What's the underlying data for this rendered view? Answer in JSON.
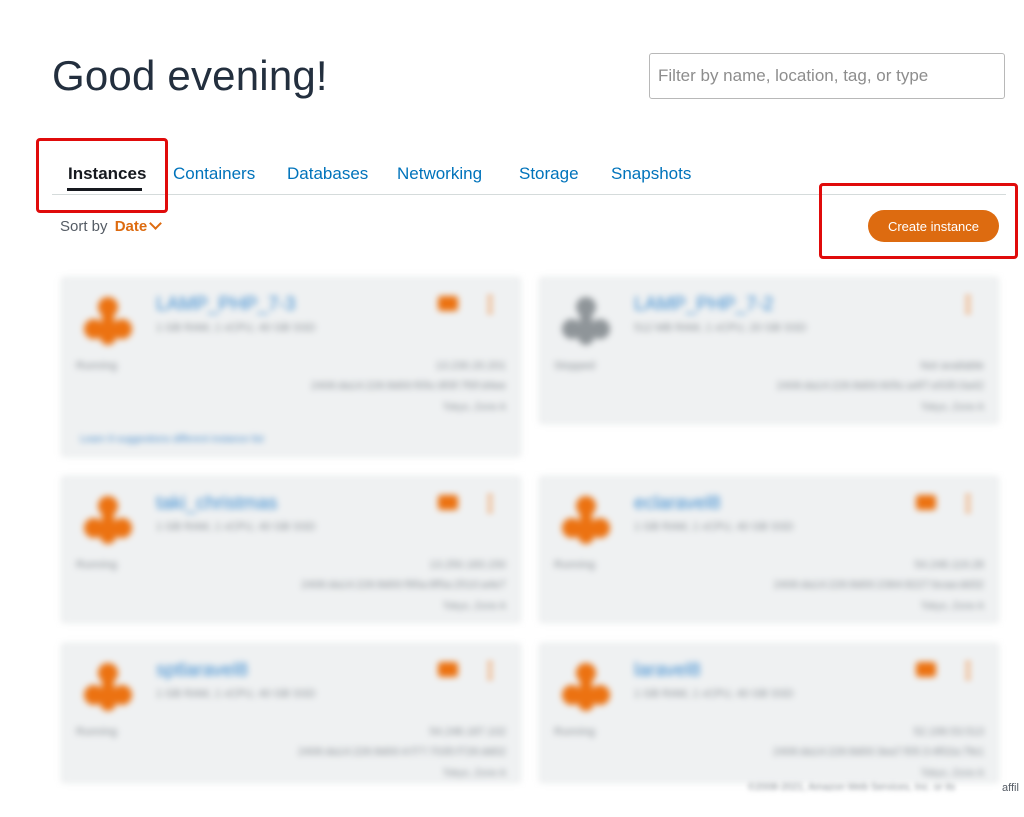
{
  "header": {
    "greeting": "Good evening!",
    "filter_placeholder": "Filter by name, location, tag, or type"
  },
  "tabs": [
    {
      "label": "Instances",
      "active": true
    },
    {
      "label": "Containers",
      "active": false
    },
    {
      "label": "Databases",
      "active": false
    },
    {
      "label": "Networking",
      "active": false
    },
    {
      "label": "Storage",
      "active": false
    },
    {
      "label": "Snapshots",
      "active": false
    }
  ],
  "sort": {
    "label": "Sort by",
    "value": "Date"
  },
  "actions": {
    "create_label": "Create instance"
  },
  "colors": {
    "accent": "#dd6b10",
    "link": "#0073bb",
    "highlight": "#e00b0b"
  },
  "instances": [
    {
      "name": "LAMP_PHP_7-3",
      "spec": "1 GB RAM, 1 vCPU, 40 GB SSD",
      "state": "Running",
      "ip": "13.230.20.201",
      "ipv6": "2406:da14:226:8d00:f05c:8f3f:7f0f:d4ee",
      "zone": "Tokyo, Zone A",
      "recommendation": "Learn 9 suggestions different instance list",
      "running": true
    },
    {
      "name": "LAMP_PHP_7-2",
      "spec": "512 MB RAM, 1 vCPU, 20 GB SSD",
      "state": "Stopped",
      "ip": "Not available",
      "ipv6": "2406:da14:226:8d00:605c:a4f7:e535:0a42",
      "zone": "Tokyo, Zone A",
      "recommendation": "",
      "running": false
    },
    {
      "name": "taki_christmas",
      "spec": "1 GB RAM, 1 vCPU, 40 GB SSD",
      "state": "Running",
      "ip": "13.250.183.150",
      "ipv6": "2406:da14:226:8d00:f95a:8f5a:2510:a4e7",
      "zone": "Tokyo, Zone A",
      "recommendation": "",
      "running": true
    },
    {
      "name": "eclaravel8",
      "spec": "1 GB RAM, 1 vCPU, 40 GB SSD",
      "state": "Running",
      "ip": "54.248.119.28",
      "ipv6": "2406:da14:226:8d00:2364:8227:bcaa:dd32",
      "zone": "Tokyo, Zone A",
      "recommendation": "",
      "running": true
    },
    {
      "name": "sptlaravel8",
      "spec": "1 GB RAM, 1 vCPU, 40 GB SSD",
      "state": "Running",
      "ip": "54.248.187.102",
      "ipv6": "2406:da14:226:8d00:4:f77:7035:f726:dd02",
      "zone": "Tokyo, Zone A",
      "recommendation": "",
      "running": true
    },
    {
      "name": "laravel8",
      "spec": "1 GB RAM, 1 vCPU, 40 GB SSD",
      "state": "Running",
      "ip": "52.199.53.513",
      "ipv6": "2406:da14:226:8d00:3ea7:f05:3:4f02a:7fe1",
      "zone": "Tokyo, Zone A",
      "recommendation": "",
      "running": true
    }
  ],
  "footer": {
    "copyright": "©2008-2021, Amazon Web Services, Inc. or its",
    "tail": "affil"
  }
}
